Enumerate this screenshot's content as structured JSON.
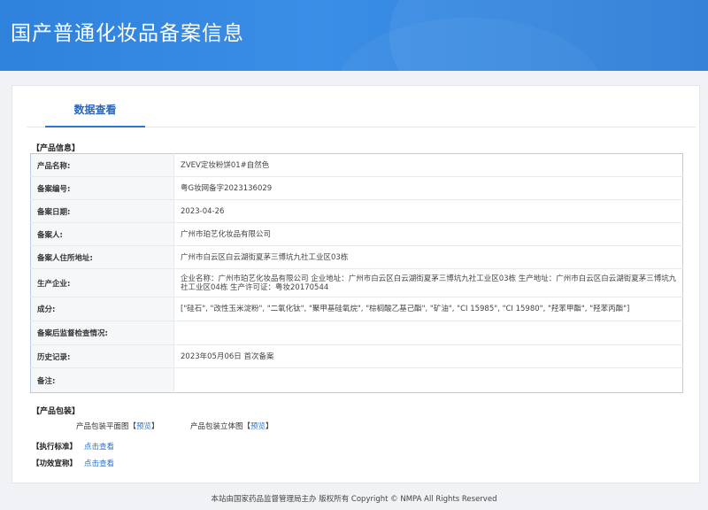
{
  "site_title": "国产普通化妆品备案信息",
  "tab_label": "数据查看",
  "product_info": {
    "section_title": "【产品信息】",
    "rows": [
      {
        "key": "产品名称:",
        "value": "ZVEV定妆粉饼01#自然色"
      },
      {
        "key": "备案编号:",
        "value": "粤G妆网备字2023136029"
      },
      {
        "key": "备案日期:",
        "value": "2023-04-26"
      },
      {
        "key": "备案人:",
        "value": "广州市珀艺化妆品有限公司"
      },
      {
        "key": "备案人住所地址:",
        "value": "广州市白云区白云湖街夏茅三博坑九社工业区03栋"
      },
      {
        "key": "生产企业:",
        "value": "企业名称：广州市珀艺化妆品有限公司 企业地址：广州市白云区白云湖街夏茅三博坑九社工业区03栋 生产地址：广州市白云区白云湖街夏茅三博坑九社工业区04栋 生产许可证：粤妆20170544"
      },
      {
        "key": "成分:",
        "value": "[\"硅石\", \"改性玉米淀粉\", \"二氧化钛\", \"聚甲基硅氧烷\", \"棕榈酸乙基己酯\", \"矿油\", \"CI 15985\", \"CI 15980\", \"羟苯甲酯\", \"羟苯丙酯\"]"
      },
      {
        "key": "备案后监督检查情况:",
        "value": ""
      },
      {
        "key": "历史记录:",
        "value": "2023年05月06日 首次备案"
      },
      {
        "key": "备注:",
        "value": ""
      }
    ]
  },
  "packaging": {
    "section_title": "【产品包装】",
    "items": [
      {
        "label": "产品包装平面图",
        "link": "预览"
      },
      {
        "label": "产品包装立体图",
        "link": "预览"
      }
    ]
  },
  "standards": {
    "label": "【执行标准】",
    "link": "点击查看"
  },
  "efficacy": {
    "label": "【功效宣称】",
    "link": "点击查看"
  },
  "footer": "本站由国家药品监督管理局主办 版权所有 Copyright © NMPA All Rights Reserved",
  "colors": {
    "header_blue": "#2f82dc",
    "link_blue": "#2b72c8",
    "table_border": "#b6cdea"
  }
}
